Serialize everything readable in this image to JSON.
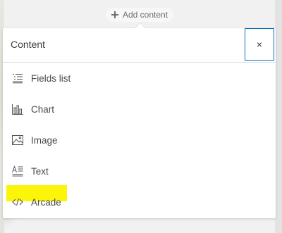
{
  "add_content": {
    "label": "Add content",
    "icon": "plus-icon"
  },
  "panel": {
    "title": "Content",
    "close_label": "×",
    "items": [
      {
        "label": "Fields list",
        "icon": "fields-list-icon"
      },
      {
        "label": "Chart",
        "icon": "bar-chart-icon"
      },
      {
        "label": "Image",
        "icon": "image-icon"
      },
      {
        "label": "Text",
        "icon": "text-icon"
      },
      {
        "label": "Arcade",
        "icon": "code-icon",
        "highlighted": true
      }
    ]
  },
  "colors": {
    "accent_border": "#0f6fba",
    "highlight": "#fbf50a",
    "text": "#4a4a4a"
  }
}
